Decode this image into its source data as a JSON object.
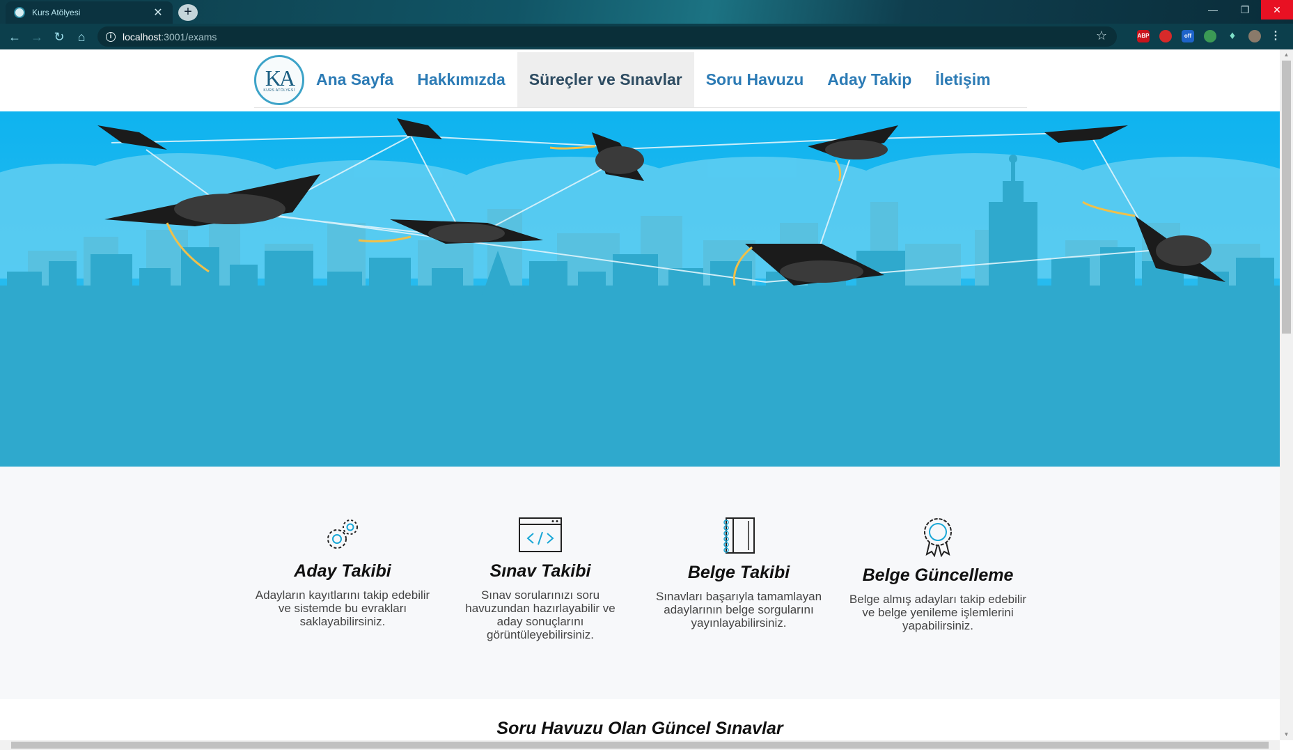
{
  "browser": {
    "tab_title": "Kurs Atölyesi",
    "tab_close": "✕",
    "new_tab": "+",
    "url_host": "localhost",
    "url_path": ":3001/exams",
    "extensions": [
      "ABP",
      "off"
    ]
  },
  "nav": {
    "logo_text": "KA",
    "logo_subtext": "KURS ATÖLYESİ",
    "items": [
      {
        "label": "Ana Sayfa"
      },
      {
        "label": "Hakkımızda"
      },
      {
        "label": "Süreçler ve Sınavlar"
      },
      {
        "label": "Soru Havuzu"
      },
      {
        "label": "Aday Takip"
      },
      {
        "label": "İletişim"
      }
    ],
    "active_index": 2
  },
  "features": [
    {
      "icon": "gears-icon",
      "title": "Aday Takibi",
      "desc": "Adayların kayıtlarını takip edebilir ve sistemde bu evrakları saklayabilirsiniz."
    },
    {
      "icon": "code-window-icon",
      "title": "Sınav Takibi",
      "desc": "Sınav sorularınızı soru havuzundan hazırlayabilir ve aday sonuçlarını görüntüleyebilirsiniz."
    },
    {
      "icon": "notebook-icon",
      "title": "Belge Takibi",
      "desc": "Sınavları başarıyla tamamlayan adaylarının belge sorgularını yayınlayabilirsiniz."
    },
    {
      "icon": "award-ribbon-icon",
      "title": "Belge Güncelleme",
      "desc": "Belge almış adayları takip edebilir ve belge yenileme işlemlerini yapabilirsiniz."
    }
  ],
  "latest_section": {
    "title": "Soru Havuzu Olan Güncel Sınavlar"
  },
  "colors": {
    "nav_link": "#2c7bb5",
    "hero_sky": "#1fb0e8",
    "hero_city": "#2ba7ca",
    "accent_icon": "#1aa7d6"
  }
}
